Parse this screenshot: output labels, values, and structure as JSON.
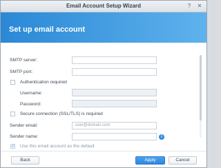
{
  "window": {
    "title": "Email Account Setup Wizard"
  },
  "header": {
    "title": "Set up email account"
  },
  "form": {
    "smtp_server_label": "SMTP server:",
    "smtp_port_label": "SMTP port:",
    "auth_required_label": "Authentication required",
    "username_label": "Username:",
    "password_label": "Password:",
    "secure_connection_label": "Secure connection (SSL/TLS) is required",
    "sender_email_label": "Sender email:",
    "sender_email_placeholder": "user@domain.com",
    "sender_name_label": "Sender name:",
    "use_default_label": "Use this email account as the default",
    "auth_required_checked": false,
    "secure_connection_checked": false,
    "use_default_checked": true
  },
  "footer": {
    "back_label": "Back",
    "apply_label": "Apply",
    "cancel_label": "Cancel"
  },
  "colors": {
    "accent": "#2f87dc",
    "header_start": "#2a88d6",
    "header_end": "#5fb2ec"
  }
}
